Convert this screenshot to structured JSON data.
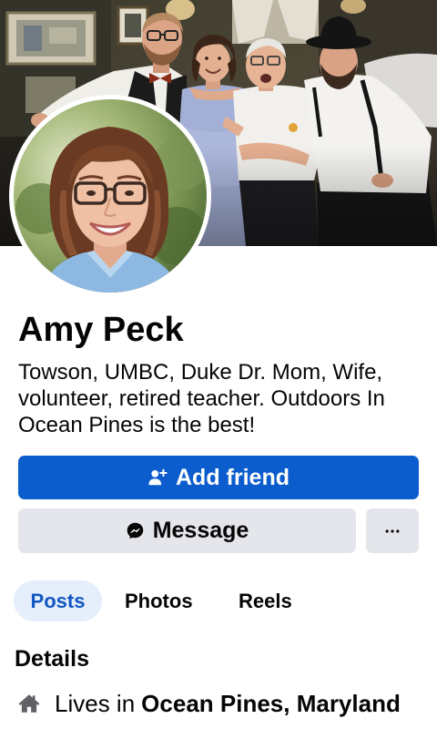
{
  "profile": {
    "name": "Amy Peck",
    "bio": "Towson, UMBC, Duke Dr. Mom, Wife, volunteer, retired teacher. Outdoors In Ocean Pines is the best!"
  },
  "actions": {
    "add_friend": {
      "label": "Add friend",
      "icon": "add-friend-icon"
    },
    "message": {
      "label": "Message",
      "icon": "messenger-icon"
    },
    "more": {
      "icon": "more-icon"
    }
  },
  "tabs": [
    {
      "label": "Posts",
      "active": true
    },
    {
      "label": "Photos",
      "active": false
    },
    {
      "label": "Reels",
      "active": false
    }
  ],
  "details": {
    "heading": "Details",
    "items": [
      {
        "icon": "home-icon",
        "prefix": "Lives in",
        "value": "Ocean Pines, Maryland"
      }
    ]
  },
  "colors": {
    "primary": "#0b5dcd",
    "primary_text": "#ffffff",
    "button_gray": "#e4e6eb",
    "tab_active_bg": "#e5eefb",
    "tab_active_text": "#1257c2",
    "text": "#050505",
    "icon_gray": "#5f6165"
  }
}
